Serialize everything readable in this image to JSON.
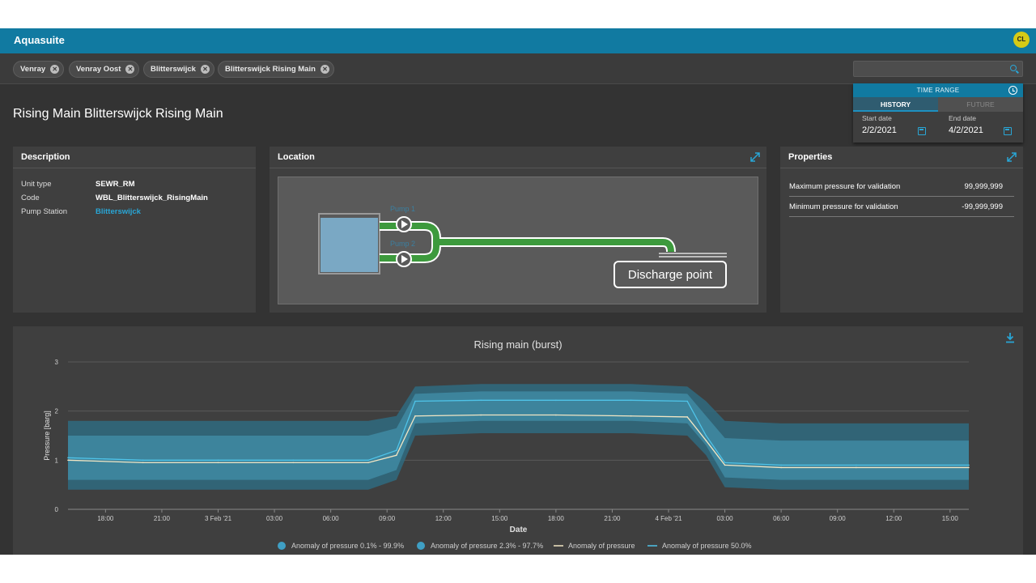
{
  "app": {
    "title": "Aquasuite",
    "user_initials": "CL"
  },
  "filters": [
    {
      "label": "Venray"
    },
    {
      "label": "Venray Oost"
    },
    {
      "label": "Blitterswijck"
    },
    {
      "label": "Blitterswijck Rising Main"
    }
  ],
  "search": {
    "placeholder": "",
    "value": ""
  },
  "page": {
    "title": "Rising Main Blitterswijck Rising Main"
  },
  "time_range": {
    "header": "TIME RANGE",
    "tabs": [
      {
        "label": "HISTORY",
        "active": true
      },
      {
        "label": "FUTURE",
        "active": false
      }
    ],
    "start_label": "Start date",
    "start_value": "2/2/2021",
    "end_label": "End date",
    "end_value": "4/2/2021"
  },
  "description": {
    "title": "Description",
    "rows": [
      {
        "label": "Unit type",
        "value": "SEWR_RM"
      },
      {
        "label": "Code",
        "value": "WBL_Blitterswijck_RisingMain"
      },
      {
        "label": "Pump Station",
        "value": "Blitterswijck",
        "link": true
      }
    ]
  },
  "location": {
    "title": "Location",
    "pump1": "Pump 1",
    "pump2": "Pump 2",
    "discharge": "Discharge point"
  },
  "properties": {
    "title": "Properties",
    "rows": [
      {
        "label": "Maximum pressure for validation",
        "value": "99,999,999"
      },
      {
        "label": "Minimum pressure for validation",
        "value": "-99,999,999"
      }
    ]
  },
  "colors": {
    "accent": "#117aa1",
    "band_outer": "#2f6b80",
    "band_inner": "#3f8aa3",
    "pressure_line": "#f2e6c4",
    "median_line": "#4fc3e8",
    "pipe_green": "#3d9a3d"
  },
  "chart_data": {
    "type": "area",
    "title": "Rising main (burst)",
    "xlabel": "Date",
    "ylabel": "Pressure [barg]",
    "ylim": [
      0,
      3
    ],
    "yticks": [
      "0",
      "1",
      "2",
      "3"
    ],
    "grid": true,
    "x_ticks": [
      "18:00",
      "21:00",
      "3 Feb '21",
      "03:00",
      "06:00",
      "09:00",
      "12:00",
      "15:00",
      "18:00",
      "21:00",
      "4 Feb '21",
      "03:00",
      "06:00",
      "09:00",
      "12:00",
      "15:00"
    ],
    "x_hours": [
      "2021-02-02T16:00",
      "2021-02-04T16:00"
    ],
    "legend_position": "bottom",
    "series": [
      {
        "name": "Anomaly of pressure 0.1% - 99.9%",
        "kind": "band",
        "x": [
          "2021-02-02T16:00",
          "2021-02-02T20:00",
          "2021-02-03T00:00",
          "2021-02-03T04:00",
          "2021-02-03T08:00",
          "2021-02-03T09:30",
          "2021-02-03T10:30",
          "2021-02-03T14:00",
          "2021-02-03T18:00",
          "2021-02-03T22:00",
          "2021-02-04T01:00",
          "2021-02-04T02:00",
          "2021-02-04T03:00",
          "2021-02-04T06:00",
          "2021-02-04T10:00",
          "2021-02-04T16:00"
        ],
        "low": [
          0.4,
          0.4,
          0.4,
          0.4,
          0.4,
          0.6,
          1.5,
          1.55,
          1.55,
          1.55,
          1.5,
          1.1,
          0.45,
          0.4,
          0.4,
          0.4
        ],
        "high": [
          1.8,
          1.8,
          1.8,
          1.8,
          1.8,
          1.9,
          2.5,
          2.55,
          2.55,
          2.55,
          2.5,
          2.2,
          1.8,
          1.75,
          1.75,
          1.75
        ]
      },
      {
        "name": "Anomaly of pressure 2.3% - 97.7%",
        "kind": "band",
        "x": [
          "2021-02-02T16:00",
          "2021-02-02T20:00",
          "2021-02-03T00:00",
          "2021-02-03T04:00",
          "2021-02-03T08:00",
          "2021-02-03T09:30",
          "2021-02-03T10:30",
          "2021-02-03T14:00",
          "2021-02-03T18:00",
          "2021-02-03T22:00",
          "2021-02-04T01:00",
          "2021-02-04T02:00",
          "2021-02-04T03:00",
          "2021-02-04T06:00",
          "2021-02-04T10:00",
          "2021-02-04T16:00"
        ],
        "low": [
          0.6,
          0.6,
          0.6,
          0.6,
          0.6,
          0.8,
          1.75,
          1.8,
          1.8,
          1.8,
          1.75,
          1.3,
          0.65,
          0.6,
          0.6,
          0.6
        ],
        "high": [
          1.5,
          1.5,
          1.5,
          1.5,
          1.5,
          1.65,
          2.35,
          2.4,
          2.4,
          2.4,
          2.35,
          1.9,
          1.45,
          1.4,
          1.4,
          1.4
        ]
      },
      {
        "name": "Anomaly of pressure",
        "kind": "line",
        "x": [
          "2021-02-02T16:00",
          "2021-02-02T20:00",
          "2021-02-03T00:00",
          "2021-02-03T04:00",
          "2021-02-03T08:00",
          "2021-02-03T09:30",
          "2021-02-03T10:30",
          "2021-02-03T14:00",
          "2021-02-03T18:00",
          "2021-02-03T22:00",
          "2021-02-04T01:00",
          "2021-02-04T02:00",
          "2021-02-04T03:00",
          "2021-02-04T06:00",
          "2021-02-04T10:00",
          "2021-02-04T16:00"
        ],
        "y": [
          1.0,
          0.95,
          0.95,
          0.95,
          0.95,
          1.1,
          1.9,
          1.92,
          1.92,
          1.9,
          1.88,
          1.4,
          0.9,
          0.85,
          0.85,
          0.85
        ]
      },
      {
        "name": "Anomaly of pressure 50.0%",
        "kind": "line",
        "x": [
          "2021-02-02T16:00",
          "2021-02-02T20:00",
          "2021-02-03T00:00",
          "2021-02-03T04:00",
          "2021-02-03T08:00",
          "2021-02-03T09:30",
          "2021-02-03T10:30",
          "2021-02-03T14:00",
          "2021-02-03T18:00",
          "2021-02-03T22:00",
          "2021-02-04T01:00",
          "2021-02-04T02:00",
          "2021-02-04T03:00",
          "2021-02-04T06:00",
          "2021-02-04T10:00",
          "2021-02-04T16:00"
        ],
        "y": [
          1.05,
          1.0,
          1.0,
          1.0,
          1.0,
          1.2,
          2.2,
          2.22,
          2.22,
          2.22,
          2.2,
          1.5,
          0.95,
          0.9,
          0.9,
          0.9
        ]
      }
    ]
  }
}
